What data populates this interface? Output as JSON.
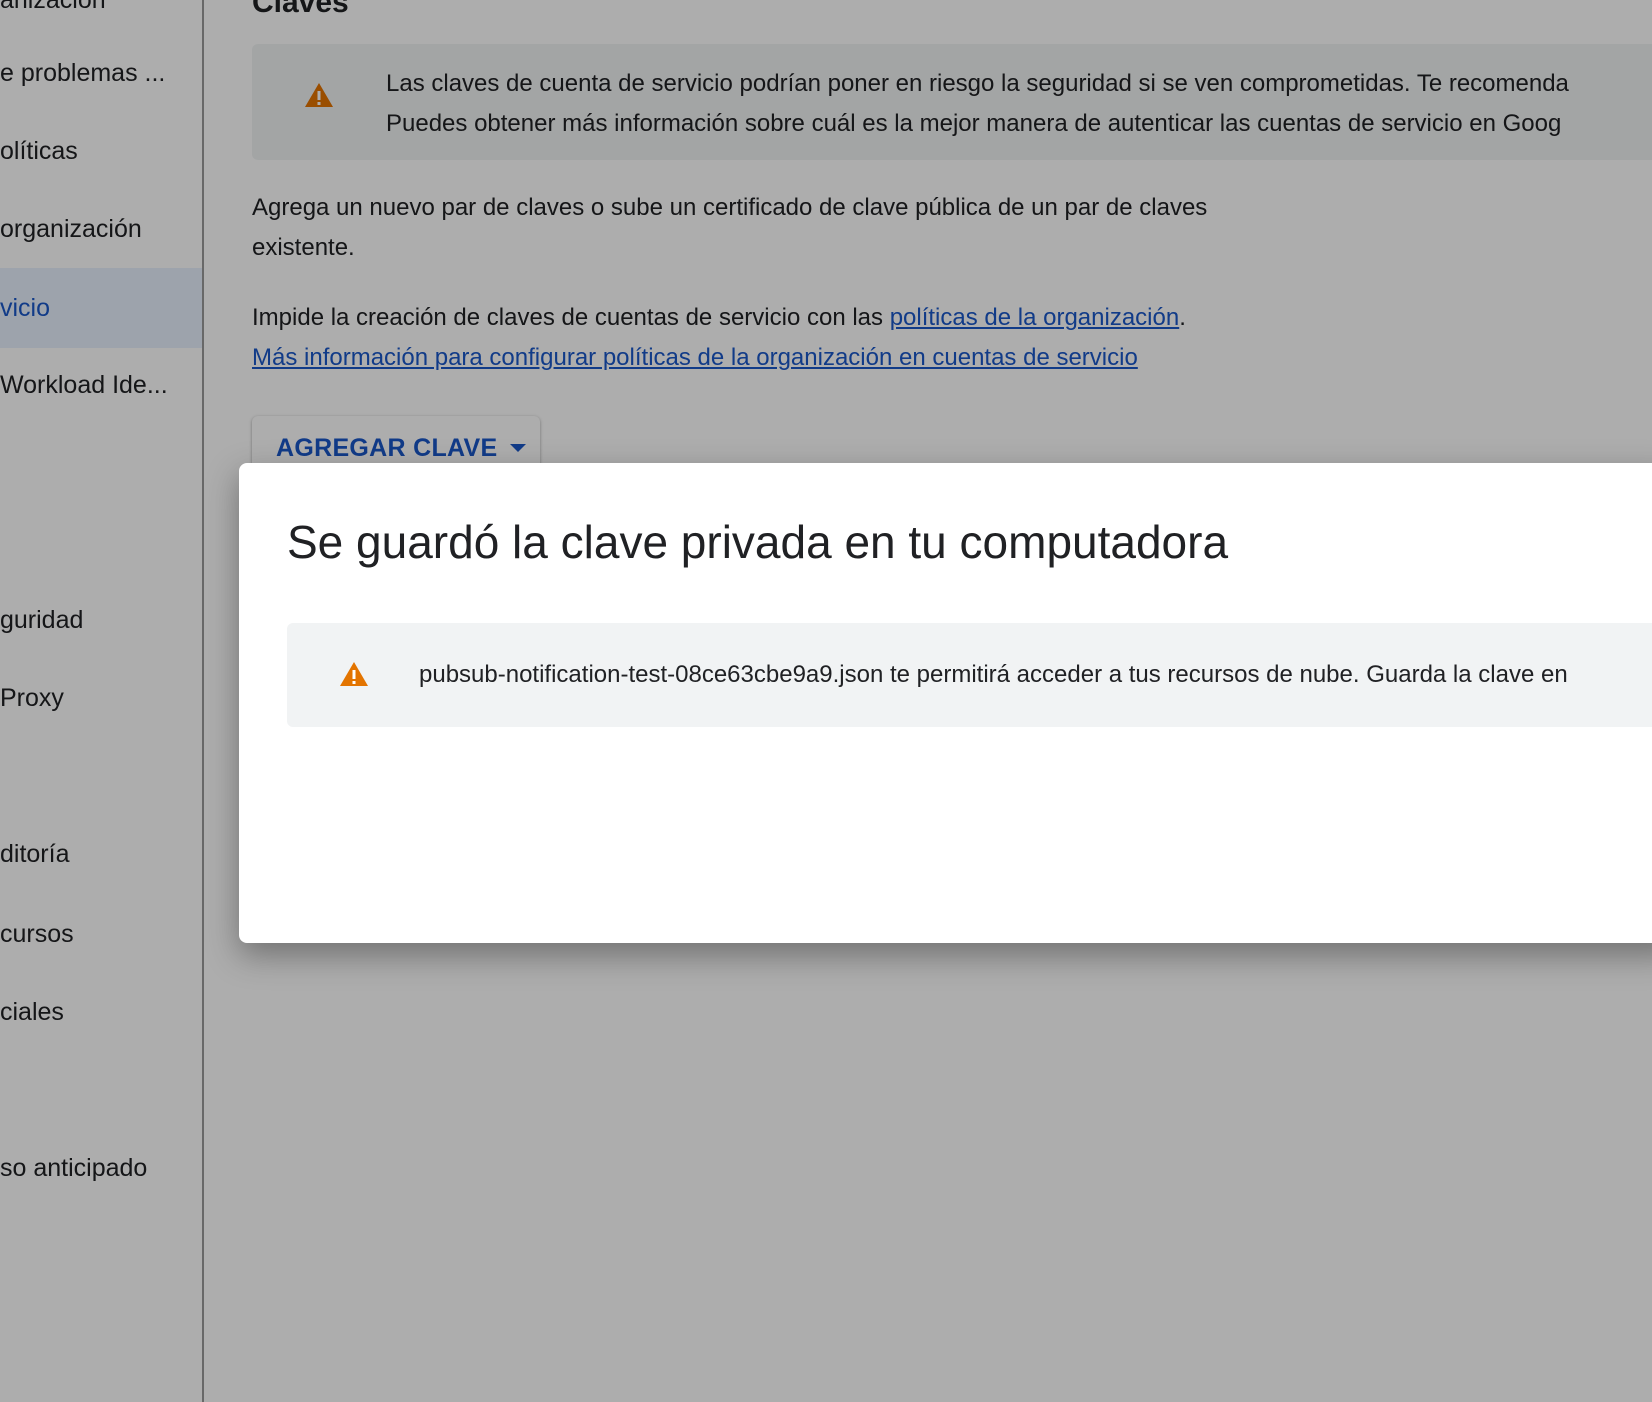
{
  "sidebar": {
    "items": [
      {
        "label": "anización"
      },
      {
        "label": "e problemas ..."
      },
      {
        "label": "olíticas"
      },
      {
        "label": "organización"
      },
      {
        "label": "vicio"
      },
      {
        "label": "Workload Ide..."
      },
      {
        "label": "guridad"
      },
      {
        "label": "Proxy"
      },
      {
        "label": "ditoría"
      },
      {
        "label": "cursos"
      },
      {
        "label": "ciales"
      },
      {
        "label": "so anticipado"
      }
    ]
  },
  "main": {
    "title": "Claves",
    "banner": {
      "line1": "Las claves de cuenta de servicio podrían poner en riesgo la seguridad si se ven comprometidas. Te recomenda",
      "line2": "Puedes obtener más información sobre cuál es la mejor manera de autenticar las cuentas de servicio en Goog"
    },
    "para1": "Agrega un nuevo par de claves o sube un certificado de clave pública de un par de claves existente.",
    "para2_prefix": "Impide la creación de claves de cuentas de servicio con las ",
    "para2_link": "políticas de la organización",
    "para2_suffix": ".",
    "para2_link2": "Más información para configurar políticas de la organización en cuentas de servicio",
    "add_key_label": "AGREGAR CLAVE"
  },
  "dialog": {
    "title": "Se guardó la clave privada en tu computadora",
    "notice": "pubsub-notification-test-08ce63cbe9a9.json te permitirá acceder a tus recursos de nube. Guarda la clave en"
  },
  "colors": {
    "accent": "#1a57c9",
    "warning": "#e37400",
    "active_bg": "#e8f0fe"
  },
  "icons": {
    "warning": "warning-icon",
    "dropdown": "caret-down-icon"
  }
}
